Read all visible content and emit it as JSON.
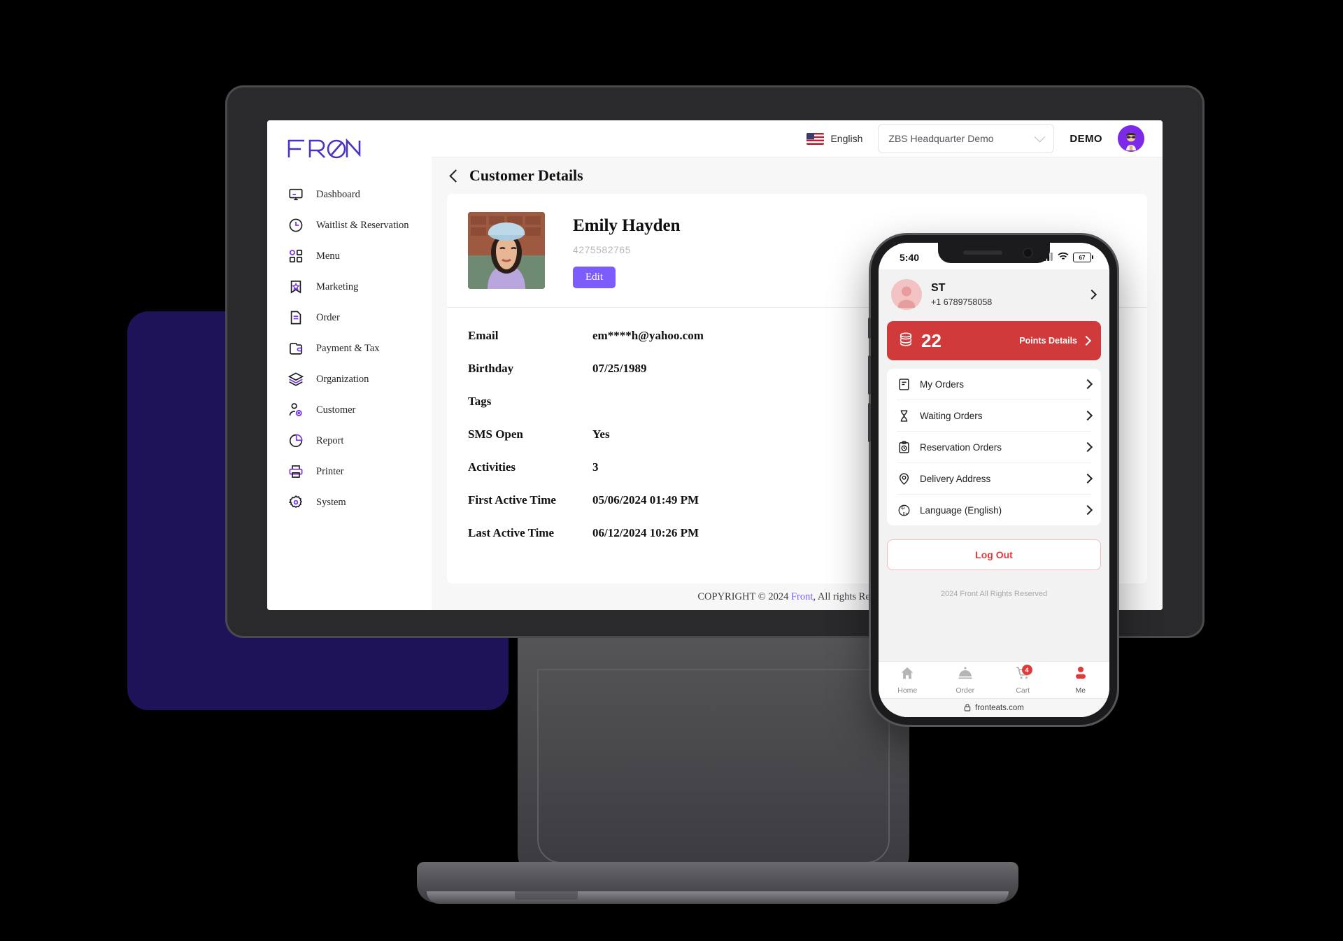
{
  "brand": {
    "name": "FRONT"
  },
  "sidebar": {
    "items": [
      {
        "label": "Dashboard",
        "icon": "monitor-icon"
      },
      {
        "label": "Waitlist & Reservation",
        "icon": "clock-icon"
      },
      {
        "label": "Menu",
        "icon": "grid-icon"
      },
      {
        "label": "Marketing",
        "icon": "bookmark-star-icon"
      },
      {
        "label": "Order",
        "icon": "document-icon"
      },
      {
        "label": "Payment & Tax",
        "icon": "wallet-icon"
      },
      {
        "label": "Organization",
        "icon": "layers-icon"
      },
      {
        "label": "Customer",
        "icon": "user-tag-icon"
      },
      {
        "label": "Report",
        "icon": "pie-chart-icon"
      },
      {
        "label": "Printer",
        "icon": "printer-icon"
      },
      {
        "label": "System",
        "icon": "gear-icon"
      }
    ]
  },
  "topbar": {
    "language": "English",
    "flag_icon": "us-flag-icon",
    "organization": "ZBS Headquarter Demo",
    "user_name": "DEMO",
    "avatar_icon": "user-avatar"
  },
  "page": {
    "title": "Customer Details",
    "back_icon": "chevron-left-icon"
  },
  "customer": {
    "photo_icon": "customer-photo",
    "name": "Emily Hayden",
    "id": "4275582765",
    "edit_label": "Edit",
    "fields": [
      {
        "key": "Email",
        "value": "em****h@yahoo.com"
      },
      {
        "key": "Birthday",
        "value": "07/25/1989"
      },
      {
        "key": "Tags",
        "value": ""
      },
      {
        "key": "SMS Open",
        "value": "Yes"
      },
      {
        "key": "Activities",
        "value": "3"
      },
      {
        "key": "First Active Time",
        "value": "05/06/2024 01:49 PM"
      },
      {
        "key": "Last Active Time",
        "value": "06/12/2024 10:26 PM"
      }
    ]
  },
  "footer": {
    "copyright_pre": "COPYRIGHT © 2024",
    "link": "Front",
    "copyright_post": ", All rights Reserved"
  },
  "phone": {
    "status": {
      "time": "5:40",
      "battery": "67",
      "signal_icon": "cellular-icon",
      "wifi_icon": "wifi-icon",
      "battery_icon": "battery-icon"
    },
    "user": {
      "avatar_icon": "profile-avatar-icon",
      "name": "ST",
      "phone": "+1 6789758058",
      "chevron_icon": "chevron-right-icon"
    },
    "points": {
      "icon": "coins-icon",
      "value": "22",
      "details_label": "Points Details",
      "chevron_icon": "chevron-right-icon",
      "color": "#d03a3a"
    },
    "menu": [
      {
        "label": "My Orders",
        "icon": "orders-icon"
      },
      {
        "label": "Waiting Orders",
        "icon": "hourglass-icon"
      },
      {
        "label": "Reservation Orders",
        "icon": "clipboard-clock-icon"
      },
      {
        "label": "Delivery Address",
        "icon": "map-pin-icon"
      },
      {
        "label": "Language  (English)",
        "icon": "translate-icon"
      }
    ],
    "logout_label": "Log Out",
    "copyright": "2024 Front All Rights Reserved",
    "tabs": [
      {
        "label": "Home",
        "icon": "home-icon",
        "badge": "",
        "active": false
      },
      {
        "label": "Order",
        "icon": "dish-cover-icon",
        "badge": "",
        "active": false
      },
      {
        "label": "Cart",
        "icon": "cart-icon",
        "badge": "4",
        "active": false
      },
      {
        "label": "Me",
        "icon": "person-icon",
        "badge": "",
        "active": true
      }
    ],
    "url": "fronteats.com",
    "lock_icon": "lock-icon"
  }
}
